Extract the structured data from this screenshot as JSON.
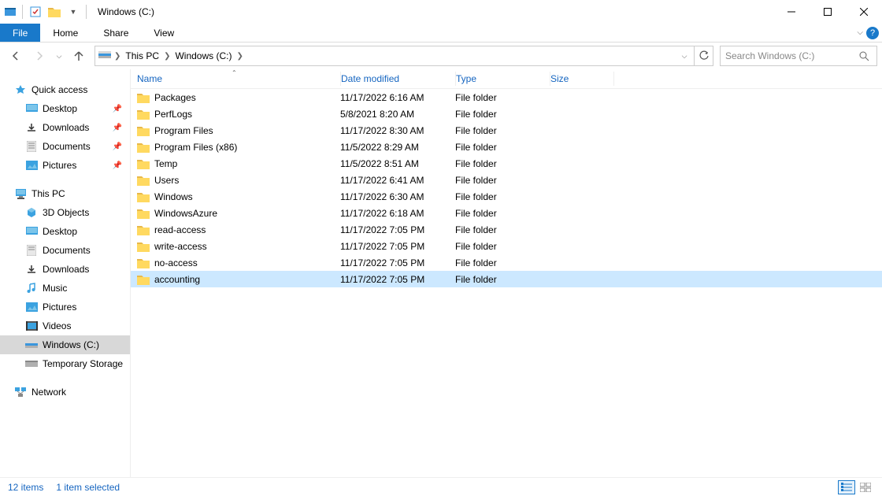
{
  "titlebar": {
    "title": "Windows (C:)"
  },
  "ribbon": {
    "file": "File",
    "home": "Home",
    "share": "Share",
    "view": "View"
  },
  "breadcrumb": {
    "this_pc": "This PC",
    "drive": "Windows (C:)"
  },
  "search": {
    "placeholder": "Search Windows (C:)"
  },
  "sidebar": {
    "quick_access": "Quick access",
    "desktop": "Desktop",
    "downloads": "Downloads",
    "documents": "Documents",
    "pictures": "Pictures",
    "this_pc": "This PC",
    "objects3d": "3D Objects",
    "desktop2": "Desktop",
    "documents2": "Documents",
    "downloads2": "Downloads",
    "music": "Music",
    "pictures2": "Pictures",
    "videos": "Videos",
    "windows_c": "Windows (C:)",
    "temp_storage": "Temporary Storage",
    "network": "Network"
  },
  "columns": {
    "name": "Name",
    "date": "Date modified",
    "type": "Type",
    "size": "Size"
  },
  "files": [
    {
      "name": "Packages",
      "date": "11/17/2022 6:16 AM",
      "type": "File folder"
    },
    {
      "name": "PerfLogs",
      "date": "5/8/2021 8:20 AM",
      "type": "File folder"
    },
    {
      "name": "Program Files",
      "date": "11/17/2022 8:30 AM",
      "type": "File folder"
    },
    {
      "name": "Program Files (x86)",
      "date": "11/5/2022 8:29 AM",
      "type": "File folder"
    },
    {
      "name": "Temp",
      "date": "11/5/2022 8:51 AM",
      "type": "File folder"
    },
    {
      "name": "Users",
      "date": "11/17/2022 6:41 AM",
      "type": "File folder"
    },
    {
      "name": "Windows",
      "date": "11/17/2022 6:30 AM",
      "type": "File folder"
    },
    {
      "name": "WindowsAzure",
      "date": "11/17/2022 6:18 AM",
      "type": "File folder"
    },
    {
      "name": "read-access",
      "date": "11/17/2022 7:05 PM",
      "type": "File folder"
    },
    {
      "name": "write-access",
      "date": "11/17/2022 7:05 PM",
      "type": "File folder"
    },
    {
      "name": "no-access",
      "date": "11/17/2022 7:05 PM",
      "type": "File folder"
    },
    {
      "name": "accounting",
      "date": "11/17/2022 7:05 PM",
      "type": "File folder"
    }
  ],
  "footer": {
    "count": "12 items",
    "selection": "1 item selected"
  }
}
